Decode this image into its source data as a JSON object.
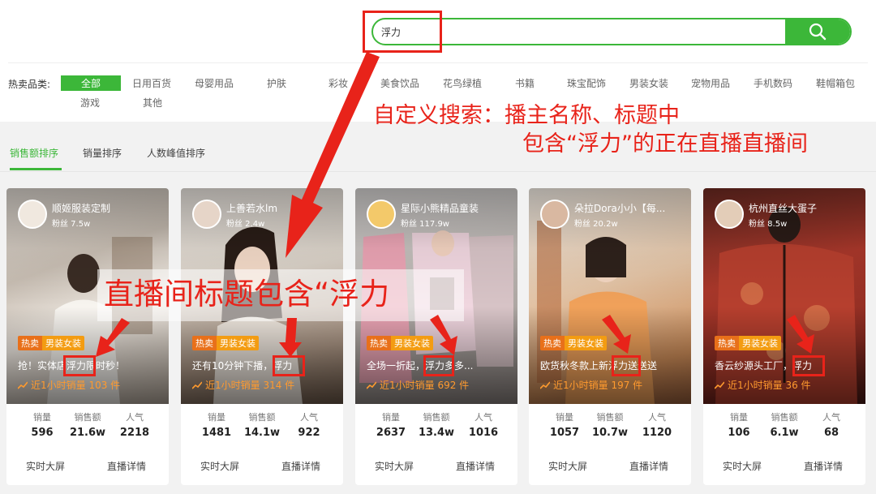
{
  "search": {
    "value": "浮力",
    "button_icon": "search-icon"
  },
  "categories": {
    "label": "热卖品类:",
    "items": [
      "全部",
      "日用百货",
      "母婴用品",
      "护肤",
      "彩妆",
      "美食饮品",
      "花鸟绿植",
      "书籍",
      "珠宝配饰",
      "男装女装",
      "宠物用品",
      "手机数码",
      "鞋帽箱包",
      "游戏",
      "其他"
    ],
    "active": "全部"
  },
  "annotations": {
    "line1": "自定义搜索：播主名称、标题中",
    "line2": "包含“浮力”的正在直播直播间",
    "overlay": "直播间标题包含“浮力",
    "color": "#e8231a"
  },
  "sort_tabs": [
    "销售额排序",
    "销量排序",
    "人数峰值排序"
  ],
  "stat_labels": [
    "销量",
    "销售额",
    "人气"
  ],
  "action_labels": [
    "实时大屏",
    "直播详情"
  ],
  "hot_tag": "热卖",
  "cards": [
    {
      "name": "顺姬服装定制",
      "fans": "粉丝 7.5w",
      "category": "男装女装",
      "title": "抢！实体店浮力限时秒！",
      "sales_hour": "近1小时销量 103 件",
      "sales": "596",
      "revenue": "21.6w",
      "popularity": "2218"
    },
    {
      "name": "上善若水lm",
      "fans": "粉丝 2.4w",
      "category": "男装女装",
      "title": "还有10分钟下播，浮力",
      "sales_hour": "近1小时销量 314 件",
      "sales": "1481",
      "revenue": "14.1w",
      "popularity": "922"
    },
    {
      "name": "星际小熊精品童装",
      "fans": "粉丝 117.9w",
      "category": "男装女装",
      "title": "全场一折起，浮力多多...",
      "sales_hour": "近1小时销量 692 件",
      "sales": "2637",
      "revenue": "13.4w",
      "popularity": "1016"
    },
    {
      "name": "朵拉Dora小小【每...",
      "fans": "粉丝 20.2w",
      "category": "男装女装",
      "title": "欧货秋冬款上新浮力送送送",
      "sales_hour": "近1小时销量 197 件",
      "sales": "1057",
      "revenue": "10.7w",
      "popularity": "1120"
    },
    {
      "name": "杭州直丝大蛋子",
      "fans": "粉丝 8.5w",
      "category": "男装女装",
      "title": "香云纱源头工厂，浮力",
      "sales_hour": "近1小时销量 36 件",
      "sales": "106",
      "revenue": "6.1w",
      "popularity": "68"
    }
  ],
  "colors": {
    "brand_green": "#3cb739",
    "tag_orange": "#e8701a",
    "sales_orange": "#ff9a2e",
    "annotation_red": "#e8231a"
  }
}
